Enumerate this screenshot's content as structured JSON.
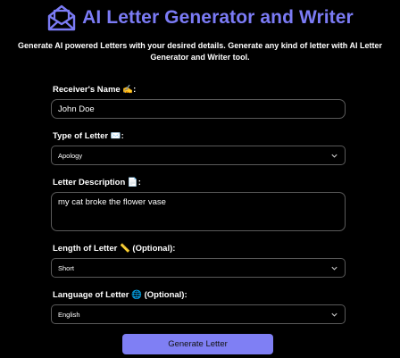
{
  "header": {
    "title": "AI Letter Generator and Writer",
    "subtitle": "Generate AI powered Letters with your desired details. Generate any kind of letter with AI Letter Generator and Writer tool.",
    "logo_icon": "envelope-icon",
    "accent_color": "#7b7bf5"
  },
  "form": {
    "receiver": {
      "label": "Receiver's Name ✍️:",
      "value": "John Doe"
    },
    "type": {
      "label": "Type of Letter ✉️:",
      "selected": "Apology"
    },
    "description": {
      "label": "Letter Description 📄:",
      "value": "my cat broke the flower vase"
    },
    "length": {
      "label": "Length of Letter 📏 (Optional):",
      "selected": "Short"
    },
    "language": {
      "label": "Language of Letter 🌐 (Optional):",
      "selected": "English"
    },
    "submit_label": "Generate Letter",
    "button_color": "#7f7ff4"
  }
}
